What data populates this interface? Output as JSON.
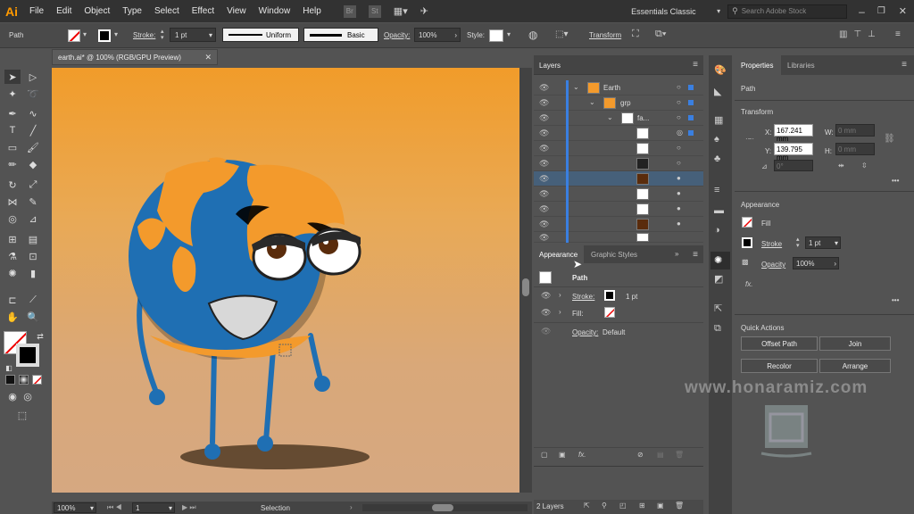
{
  "app": {
    "logo": "Ai",
    "menu": [
      "File",
      "Edit",
      "Object",
      "Type",
      "Select",
      "Effect",
      "View",
      "Window",
      "Help"
    ],
    "workspace": "Essentials Classic",
    "search_placeholder": "Search Adobe Stock"
  },
  "control": {
    "selection": "Path",
    "stroke_label": "Stroke:",
    "stroke_value": "1 pt",
    "profile": "Uniform",
    "brush": "Basic",
    "opacity_label": "Opacity:",
    "opacity_value": "100%",
    "style_label": "Style:",
    "transform": "Transform"
  },
  "document": {
    "tab_title": "earth.ai* @ 100% (RGB/GPU Preview)"
  },
  "status": {
    "zoom": "100%",
    "artboard": "1",
    "tool": "Selection"
  },
  "layers": {
    "tab": "Layers",
    "rows": [
      {
        "name": "Earth"
      },
      {
        "name": "grp"
      },
      {
        "name": "fa..."
      }
    ],
    "footer": "2 Layers"
  },
  "appearance": {
    "tabs": [
      "Appearance",
      "Graphic Styles"
    ],
    "title": "Path",
    "stroke_label": "Stroke:",
    "stroke_value": "1 pt",
    "fill_label": "Fill:",
    "opacity_label": "Opacity:",
    "opacity_value": "Default"
  },
  "properties": {
    "tabs": [
      "Properties",
      "Libraries"
    ],
    "selection": "Path",
    "transform_heading": "Transform",
    "x_label": "X:",
    "x_value": "167.241 mm",
    "y_label": "Y:",
    "y_value": "139.795 mm",
    "w_label": "W:",
    "w_value": "0 mm",
    "h_label": "H:",
    "h_value": "0 mm",
    "angle_value": "0°",
    "appearance_heading": "Appearance",
    "fill_label": "Fill",
    "stroke_label": "Stroke",
    "stroke_value": "1 pt",
    "opacity_label": "Opacity",
    "opacity_value": "100%",
    "quick_heading": "Quick Actions",
    "buttons": [
      "Offset Path",
      "Join",
      "Recolor",
      "Arrange"
    ]
  },
  "watermark": {
    "url": "www.honaramiz.com"
  },
  "colors": {
    "accent": "#ff9a00",
    "selected_row": "#46607a",
    "globe_blue": "#1f6fb3",
    "land_orange": "#f39a2c"
  }
}
